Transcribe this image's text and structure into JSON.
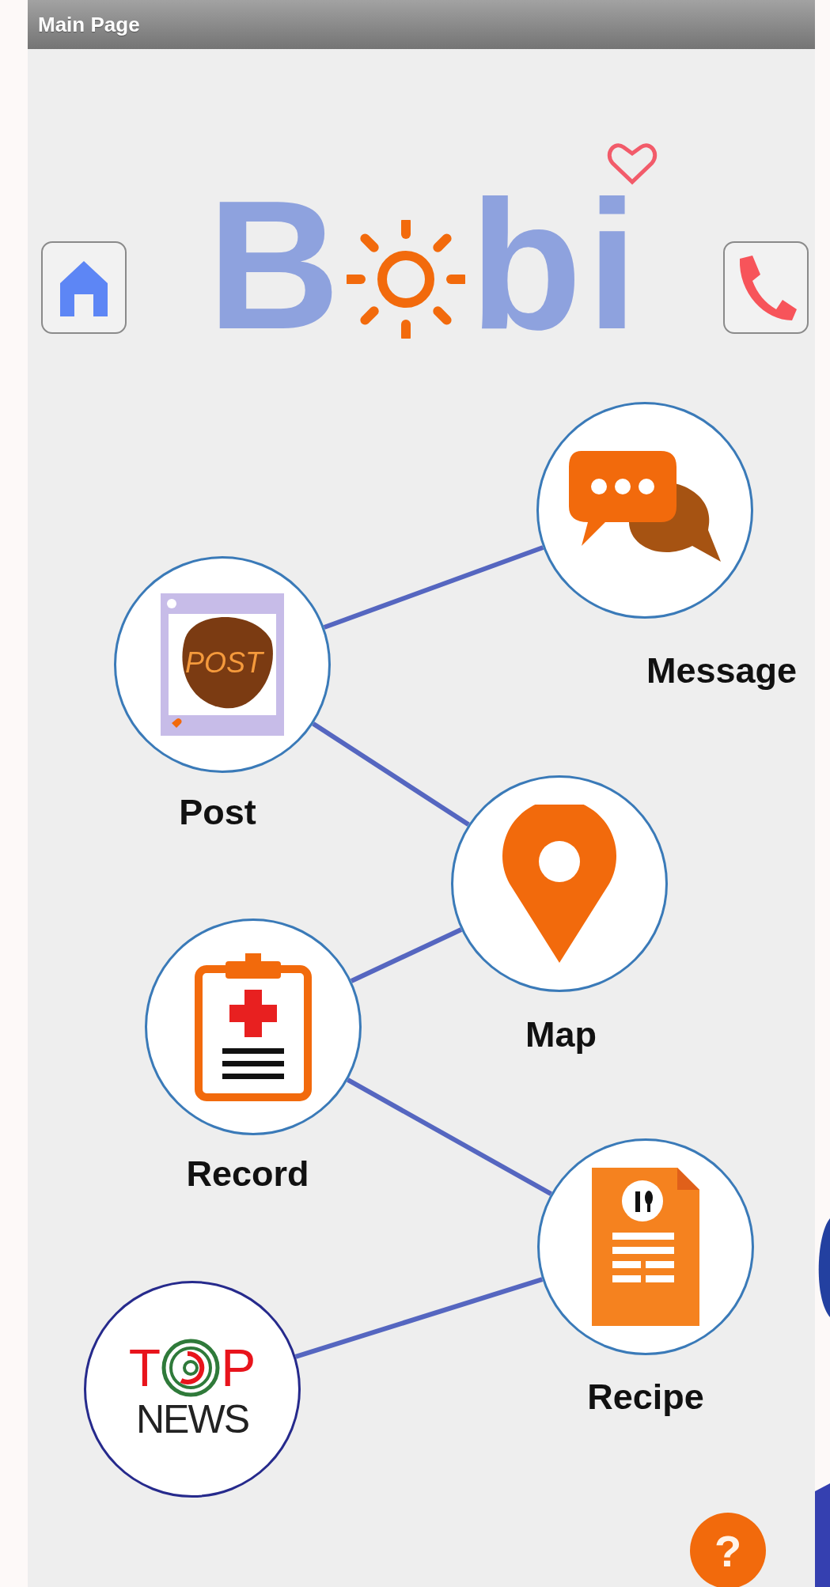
{
  "title_bar": {
    "title": "Main Page"
  },
  "header": {
    "logo": {
      "start": "B",
      "end": "bi"
    }
  },
  "nodes": [
    {
      "kind": "message",
      "label": "Message"
    },
    {
      "kind": "post",
      "label": "Post",
      "icon_text": "POST"
    },
    {
      "kind": "map",
      "label": "Map"
    },
    {
      "kind": "record",
      "label": "Record"
    },
    {
      "kind": "recipe",
      "label": "Recipe"
    },
    {
      "kind": "news",
      "logo_start": "T",
      "logo_end": "P",
      "logo_bottom": "NEWS"
    }
  ],
  "help_button": {
    "label": "?"
  }
}
